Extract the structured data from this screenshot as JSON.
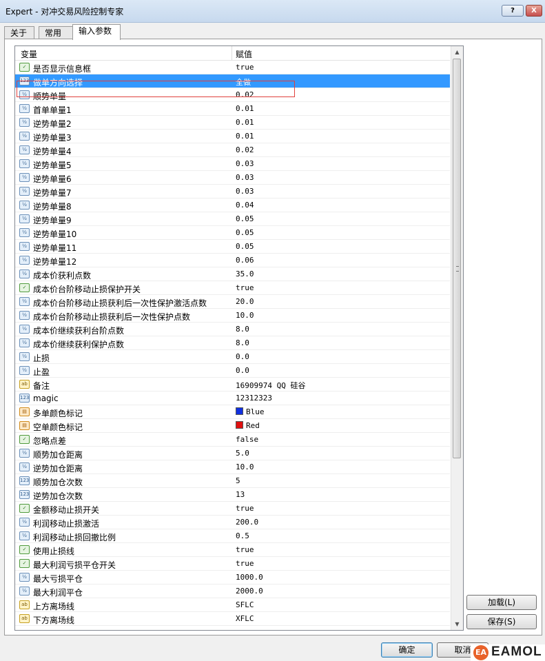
{
  "window": {
    "title": "Expert - 对冲交易风险控制专家",
    "help_label": "?",
    "close_label": "X"
  },
  "tabs": [
    {
      "label": "关于"
    },
    {
      "label": "常用"
    },
    {
      "label": "输入参数"
    }
  ],
  "grid": {
    "col_variable": "变量",
    "col_value": "赋值",
    "rows": [
      {
        "name": "是否显示信息框",
        "value": "true",
        "icon": "bool"
      },
      {
        "name": "做单方向选择",
        "value": "全做",
        "icon": "int",
        "selected": true
      },
      {
        "name": "顺势单量",
        "value": "0.02",
        "icon": "num"
      },
      {
        "name": "首单单量1",
        "value": "0.01",
        "icon": "num"
      },
      {
        "name": "逆势单量2",
        "value": "0.01",
        "icon": "num"
      },
      {
        "name": "逆势单量3",
        "value": "0.01",
        "icon": "num"
      },
      {
        "name": "逆势单量4",
        "value": "0.02",
        "icon": "num"
      },
      {
        "name": "逆势单量5",
        "value": "0.03",
        "icon": "num"
      },
      {
        "name": "逆势单量6",
        "value": "0.03",
        "icon": "num"
      },
      {
        "name": "逆势单量7",
        "value": "0.03",
        "icon": "num"
      },
      {
        "name": "逆势单量8",
        "value": "0.04",
        "icon": "num"
      },
      {
        "name": "逆势单量9",
        "value": "0.05",
        "icon": "num"
      },
      {
        "name": "逆势单量10",
        "value": "0.05",
        "icon": "num"
      },
      {
        "name": "逆势单量11",
        "value": "0.05",
        "icon": "num"
      },
      {
        "name": "逆势单量12",
        "value": "0.06",
        "icon": "num"
      },
      {
        "name": "成本价获利点数",
        "value": "35.0",
        "icon": "num"
      },
      {
        "name": "成本价台阶移动止损保护开关",
        "value": "true",
        "icon": "bool"
      },
      {
        "name": "成本价台阶移动止损获利后一次性保护激活点数",
        "value": "20.0",
        "icon": "num"
      },
      {
        "name": "成本价台阶移动止损获利后一次性保护点数",
        "value": "10.0",
        "icon": "num"
      },
      {
        "name": "成本价继续获利台阶点数",
        "value": "8.0",
        "icon": "num"
      },
      {
        "name": "成本价继续获利保护点数",
        "value": "8.0",
        "icon": "num"
      },
      {
        "name": "止损",
        "value": "0.0",
        "icon": "num"
      },
      {
        "name": "止盈",
        "value": "0.0",
        "icon": "num"
      },
      {
        "name": "备注",
        "value": "16909974 QQ 硅谷",
        "icon": "ab"
      },
      {
        "name": "magic",
        "value": "12312323",
        "icon": "int"
      },
      {
        "name": "多单颜色标记",
        "value": "Blue",
        "icon": "clr",
        "swatch": "#1030e0"
      },
      {
        "name": "空单颜色标记",
        "value": "Red",
        "icon": "clr",
        "swatch": "#e01010"
      },
      {
        "name": "忽略点差",
        "value": "false",
        "icon": "bool"
      },
      {
        "name": "顺势加仓距离",
        "value": "5.0",
        "icon": "num"
      },
      {
        "name": "逆势加仓距离",
        "value": "10.0",
        "icon": "num"
      },
      {
        "name": "顺势加仓次数",
        "value": "5",
        "icon": "int"
      },
      {
        "name": "逆势加仓次数",
        "value": "13",
        "icon": "int"
      },
      {
        "name": "金额移动止损开关",
        "value": "true",
        "icon": "bool"
      },
      {
        "name": "利润移动止损激活",
        "value": "200.0",
        "icon": "num"
      },
      {
        "name": "利润移动止损回撤比例",
        "value": "0.5",
        "icon": "num"
      },
      {
        "name": "使用止损线",
        "value": "true",
        "icon": "bool"
      },
      {
        "name": "最大利润亏损平仓开关",
        "value": "true",
        "icon": "bool"
      },
      {
        "name": "最大亏损平仓",
        "value": "1000.0",
        "icon": "num"
      },
      {
        "name": "最大利润平仓",
        "value": "2000.0",
        "icon": "num"
      },
      {
        "name": "上方离场线",
        "value": "SFLC",
        "icon": "ab"
      },
      {
        "name": "下方离场线",
        "value": "XFLC",
        "icon": "ab"
      }
    ]
  },
  "icons": {
    "bool": "✓",
    "num": "½",
    "int": "123",
    "ab": "ab",
    "clr": "▤"
  },
  "buttons": {
    "load_label": "加载(L)",
    "save_label": "保存(S)",
    "ok_label": "确定",
    "cancel_label": "取消"
  },
  "watermark": {
    "logo_label": "EA",
    "text": "EAMOL"
  },
  "colors": {
    "selection": "#3399ff",
    "highlight_box": "#e0403c"
  }
}
